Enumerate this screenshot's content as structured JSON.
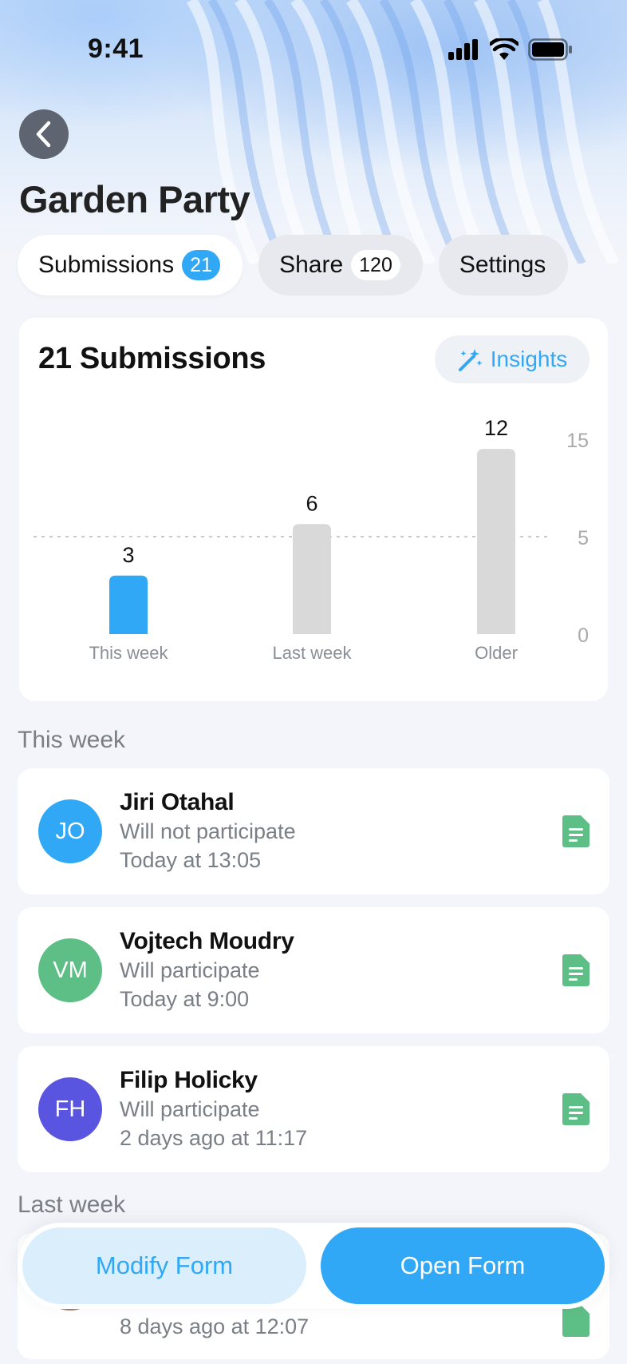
{
  "status_bar": {
    "time": "9:41"
  },
  "header": {
    "title": "Garden Party"
  },
  "tabs": [
    {
      "label": "Submissions",
      "badge": "21"
    },
    {
      "label": "Share",
      "badge": "120"
    },
    {
      "label": "Settings"
    }
  ],
  "summary_card": {
    "title": "21 Submissions",
    "insights_label": "Insights"
  },
  "chart_data": {
    "type": "bar",
    "categories": [
      "This week",
      "Last week",
      "Older"
    ],
    "values": [
      3,
      6,
      12
    ],
    "ytick_labels": [
      "15",
      "5",
      "0"
    ],
    "ylim": [
      0,
      15
    ],
    "highlight_color": "#31a8f5",
    "bar_color": "#d9d9d9"
  },
  "sections": [
    {
      "label": "This week",
      "items": [
        {
          "initials": "JO",
          "name": "Jiri Otahal",
          "status": "Will not participate",
          "time": "Today at 13:05",
          "avatar_color": "#31a8f5"
        },
        {
          "initials": "VM",
          "name": "Vojtech Moudry",
          "status": "Will participate",
          "time": "Today at 9:00",
          "avatar_color": "#5dbf85"
        },
        {
          "initials": "FH",
          "name": "Filip Holicky",
          "status": "Will participate",
          "time": "2 days ago at 11:17",
          "avatar_color": "#5a55e0"
        }
      ]
    },
    {
      "label": "Last week",
      "items": [
        {
          "time": "8 days ago at 12:07",
          "avatar_color": "#a87b6c"
        }
      ]
    }
  ],
  "actions": {
    "modify_label": "Modify Form",
    "open_label": "Open Form"
  },
  "colors": {
    "accent": "#31a8f5",
    "doc_icon": "#5dbf85"
  }
}
